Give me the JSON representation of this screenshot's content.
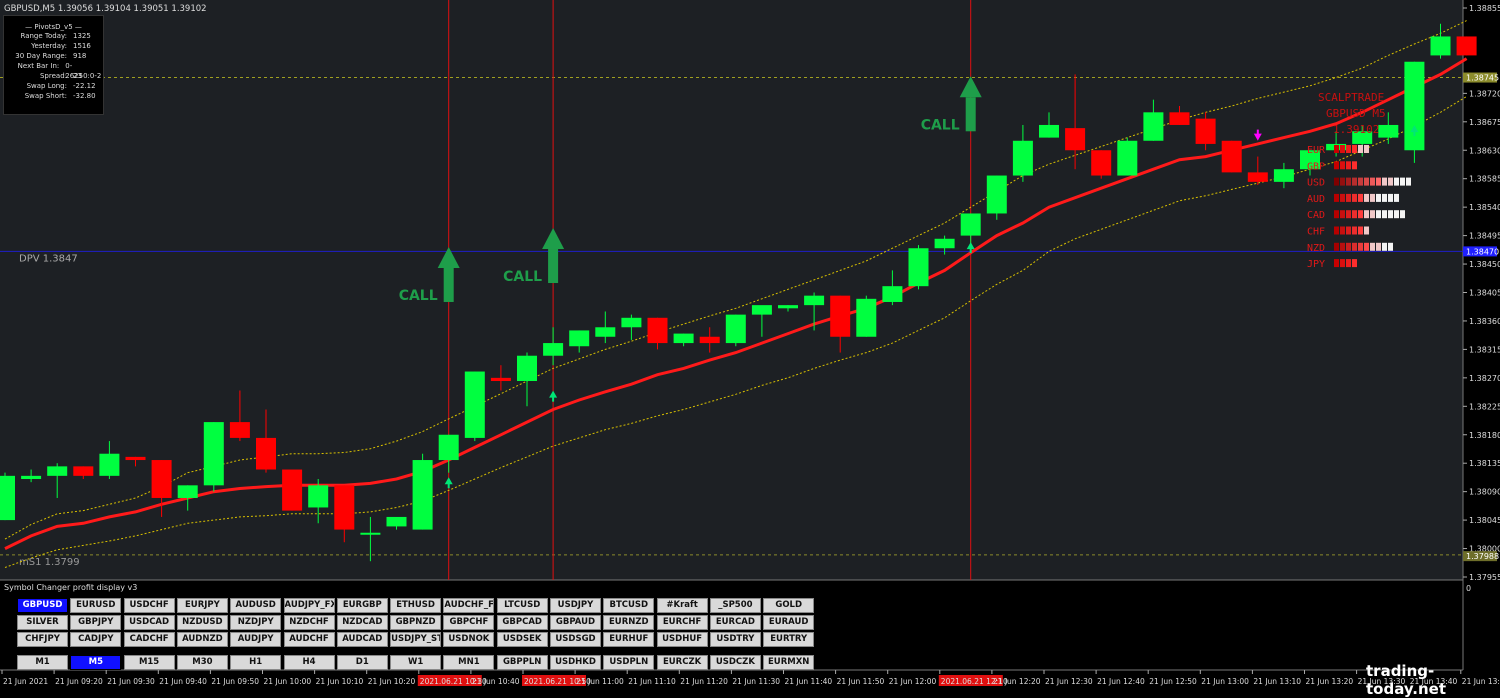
{
  "header": {
    "symbol_line": "GBPUSD,M5  1.39056 1.39104 1.39051 1.39102"
  },
  "info_panel": {
    "title": "PivotsD_v5",
    "rows": [
      {
        "label": "Range  Today:",
        "value": "1325"
      },
      {
        "label": "Yesterday:",
        "value": "1516"
      },
      {
        "label": "30 Day Range:",
        "value": "918"
      },
      {
        "label": "Next Bar In:",
        "value": "0-26250:0-2"
      },
      {
        "label": "Spread:",
        "value": "23"
      },
      {
        "label": "Swap  Long:",
        "value": "-22.12"
      },
      {
        "label": "Swap  Short:",
        "value": "-32.80"
      }
    ]
  },
  "levels": [
    {
      "text": "DPV  1.3847",
      "price": 1.3847,
      "color": "#1e1ec8"
    },
    {
      "text": "mS1  1.3799",
      "price": 1.3799,
      "color": "#8a8a2a"
    },
    {
      "text": "",
      "price": 1.38745,
      "color": "#a0a020"
    }
  ],
  "price_axis": {
    "ticks": [
      "1.38855",
      "1.38720",
      "1.38675",
      "1.38630",
      "1.38585",
      "1.38540",
      "1.38495",
      "1.38450",
      "1.38405",
      "1.38360",
      "1.38315",
      "1.38270",
      "1.38225",
      "1.38180",
      "1.38135",
      "1.38090",
      "1.38045",
      "1.38000",
      "1.37955"
    ],
    "tick_values": [
      1.38855,
      1.3872,
      1.38675,
      1.3863,
      1.38585,
      1.3854,
      1.38495,
      1.3845,
      1.38405,
      1.3836,
      1.38315,
      1.3827,
      1.38225,
      1.3818,
      1.38135,
      1.3809,
      1.38045,
      1.38,
      1.37955
    ],
    "highlight_labels": [
      {
        "text": "1.38745",
        "price": 1.38745,
        "color": "#8c8c2c"
      },
      {
        "text": "1.38470",
        "price": 1.3847,
        "color": "#2020ff"
      },
      {
        "text": "1.37988",
        "price": 1.37988,
        "color": "#6e6e2a"
      }
    ],
    "subwindow_label": "0"
  },
  "time_axis": {
    "labels": [
      "21 Jun 2021",
      "21 Jun 09:20",
      "21 Jun 09:30",
      "21 Jun 09:40",
      "21 Jun 09:50",
      "21 Jun 10:00",
      "21 Jun 10:10",
      "21 Jun 10:20",
      "2021.06.21 10:30",
      "21 Jun 10:40",
      "2021.06.21 10:50",
      "21 Jun 11:00",
      "21 Jun 11:10",
      "21 Jun 11:20",
      "21 Jun 11:30",
      "21 Jun 11:40",
      "21 Jun 11:50",
      "21 Jun 12:00",
      "2021.06.21 12:10",
      "21 Jun 12:20",
      "21 Jun 12:30",
      "21 Jun 12:40",
      "21 Jun 12:50",
      "21 Jun 13:00",
      "21 Jun 13:10",
      "21 Jun 13:20",
      "21 Jun 13:30",
      "21 Jun 13:40",
      "21 Jun 13:5"
    ],
    "highlighted": [
      8,
      10,
      18
    ]
  },
  "chart_data": {
    "type": "candlestick",
    "candles": [
      {
        "o": 1.38045,
        "h": 1.3812,
        "l": 1.38045,
        "c": 1.38115
      },
      {
        "o": 1.3811,
        "h": 1.38125,
        "l": 1.38105,
        "c": 1.38115
      },
      {
        "o": 1.38115,
        "h": 1.38135,
        "l": 1.3808,
        "c": 1.3813
      },
      {
        "o": 1.3813,
        "h": 1.3813,
        "l": 1.3811,
        "c": 1.38115
      },
      {
        "o": 1.38115,
        "h": 1.3817,
        "l": 1.3811,
        "c": 1.3815
      },
      {
        "o": 1.38145,
        "h": 1.38145,
        "l": 1.3813,
        "c": 1.3814
      },
      {
        "o": 1.3814,
        "h": 1.3814,
        "l": 1.3805,
        "c": 1.3808
      },
      {
        "o": 1.3808,
        "h": 1.381,
        "l": 1.3806,
        "c": 1.381
      },
      {
        "o": 1.381,
        "h": 1.382,
        "l": 1.3809,
        "c": 1.382
      },
      {
        "o": 1.382,
        "h": 1.3825,
        "l": 1.3817,
        "c": 1.38175
      },
      {
        "o": 1.38175,
        "h": 1.3822,
        "l": 1.3812,
        "c": 1.38125
      },
      {
        "o": 1.38125,
        "h": 1.3812,
        "l": 1.3806,
        "c": 1.3806
      },
      {
        "o": 1.38065,
        "h": 1.3811,
        "l": 1.3804,
        "c": 1.381
      },
      {
        "o": 1.381,
        "h": 1.381,
        "l": 1.3801,
        "c": 1.3803
      },
      {
        "o": 1.38025,
        "h": 1.3805,
        "l": 1.3798,
        "c": 1.38025
      },
      {
        "o": 1.38035,
        "h": 1.3805,
        "l": 1.3803,
        "c": 1.3805
      },
      {
        "o": 1.3803,
        "h": 1.3815,
        "l": 1.3803,
        "c": 1.3814
      },
      {
        "o": 1.3814,
        "h": 1.3818,
        "l": 1.3812,
        "c": 1.3818
      },
      {
        "o": 1.38175,
        "h": 1.3828,
        "l": 1.3817,
        "c": 1.3828
      },
      {
        "o": 1.3827,
        "h": 1.3829,
        "l": 1.3825,
        "c": 1.38265
      },
      {
        "o": 1.38265,
        "h": 1.3831,
        "l": 1.38225,
        "c": 1.38305
      },
      {
        "o": 1.38305,
        "h": 1.3835,
        "l": 1.3829,
        "c": 1.38325
      },
      {
        "o": 1.3832,
        "h": 1.38345,
        "l": 1.3831,
        "c": 1.38345
      },
      {
        "o": 1.38335,
        "h": 1.38375,
        "l": 1.38325,
        "c": 1.3835
      },
      {
        "o": 1.3835,
        "h": 1.3837,
        "l": 1.3833,
        "c": 1.38365
      },
      {
        "o": 1.38365,
        "h": 1.38365,
        "l": 1.38315,
        "c": 1.38325
      },
      {
        "o": 1.38325,
        "h": 1.3834,
        "l": 1.3832,
        "c": 1.3834
      },
      {
        "o": 1.38335,
        "h": 1.3835,
        "l": 1.3831,
        "c": 1.38325
      },
      {
        "o": 1.38325,
        "h": 1.3837,
        "l": 1.3832,
        "c": 1.3837
      },
      {
        "o": 1.3837,
        "h": 1.3838,
        "l": 1.38335,
        "c": 1.38385
      },
      {
        "o": 1.3838,
        "h": 1.38385,
        "l": 1.38375,
        "c": 1.38385
      },
      {
        "o": 1.38385,
        "h": 1.38405,
        "l": 1.38345,
        "c": 1.384
      },
      {
        "o": 1.384,
        "h": 1.384,
        "l": 1.3831,
        "c": 1.38335
      },
      {
        "o": 1.38335,
        "h": 1.384,
        "l": 1.38335,
        "c": 1.38395
      },
      {
        "o": 1.3839,
        "h": 1.3844,
        "l": 1.38385,
        "c": 1.38415
      },
      {
        "o": 1.38415,
        "h": 1.3848,
        "l": 1.3841,
        "c": 1.38475
      },
      {
        "o": 1.38475,
        "h": 1.38495,
        "l": 1.38465,
        "c": 1.3849
      },
      {
        "o": 1.38495,
        "h": 1.3853,
        "l": 1.3848,
        "c": 1.3853
      },
      {
        "o": 1.3853,
        "h": 1.3859,
        "l": 1.3852,
        "c": 1.3859
      },
      {
        "o": 1.3859,
        "h": 1.3867,
        "l": 1.3858,
        "c": 1.38645
      },
      {
        "o": 1.3865,
        "h": 1.3869,
        "l": 1.3865,
        "c": 1.3867
      },
      {
        "o": 1.38665,
        "h": 1.3875,
        "l": 1.386,
        "c": 1.3863
      },
      {
        "o": 1.3863,
        "h": 1.3863,
        "l": 1.38585,
        "c": 1.3859
      },
      {
        "o": 1.3859,
        "h": 1.3865,
        "l": 1.3859,
        "c": 1.38645
      },
      {
        "o": 1.38645,
        "h": 1.3871,
        "l": 1.38645,
        "c": 1.3869
      },
      {
        "o": 1.3869,
        "h": 1.387,
        "l": 1.3867,
        "c": 1.3867
      },
      {
        "o": 1.3868,
        "h": 1.3869,
        "l": 1.3863,
        "c": 1.3864
      },
      {
        "o": 1.38645,
        "h": 1.38645,
        "l": 1.38595,
        "c": 1.38595
      },
      {
        "o": 1.38595,
        "h": 1.3862,
        "l": 1.38575,
        "c": 1.3858
      },
      {
        "o": 1.3858,
        "h": 1.3861,
        "l": 1.3857,
        "c": 1.386
      },
      {
        "o": 1.386,
        "h": 1.3863,
        "l": 1.3859,
        "c": 1.3863
      },
      {
        "o": 1.3863,
        "h": 1.3866,
        "l": 1.3862,
        "c": 1.3864
      },
      {
        "o": 1.3864,
        "h": 1.3867,
        "l": 1.3862,
        "c": 1.3866
      },
      {
        "o": 1.3865,
        "h": 1.3869,
        "l": 1.3864,
        "c": 1.3867
      },
      {
        "o": 1.3863,
        "h": 1.3877,
        "l": 1.3861,
        "c": 1.3877
      },
      {
        "o": 1.3878,
        "h": 1.3883,
        "l": 1.38775,
        "c": 1.3881
      },
      {
        "o": 1.3881,
        "h": 1.3881,
        "l": 1.3878,
        "c": 1.3878
      }
    ],
    "bull_color": "#00ff40",
    "bear_color": "#ff0000",
    "ma_red": [
      1.38,
      1.3802,
      1.38035,
      1.3804,
      1.3805,
      1.38058,
      1.3807,
      1.3808,
      1.3809,
      1.38095,
      1.38098,
      1.381,
      1.381,
      1.381,
      1.38103,
      1.3811,
      1.38122,
      1.3814,
      1.3816,
      1.3818,
      1.382,
      1.3822,
      1.38235,
      1.38248,
      1.3826,
      1.38275,
      1.38285,
      1.38298,
      1.3831,
      1.38325,
      1.3834,
      1.38355,
      1.38368,
      1.3838,
      1.38398,
      1.3842,
      1.3844,
      1.38468,
      1.38495,
      1.38515,
      1.3854,
      1.38555,
      1.3857,
      1.38585,
      1.386,
      1.38615,
      1.3862,
      1.3863,
      1.3864,
      1.3865,
      1.3866,
      1.38672,
      1.3869,
      1.3871,
      1.3873,
      1.3875,
      1.38775
    ],
    "ma_upper": [
      1.38015,
      1.38038,
      1.38055,
      1.3806,
      1.3807,
      1.3808,
      1.38098,
      1.3812,
      1.3813,
      1.3814,
      1.38145,
      1.3815,
      1.3815,
      1.38152,
      1.38158,
      1.3817,
      1.38185,
      1.38205,
      1.38225,
      1.38245,
      1.38265,
      1.38285,
      1.383,
      1.38315,
      1.38328,
      1.38342,
      1.38355,
      1.38368,
      1.3838,
      1.38395,
      1.3841,
      1.38425,
      1.3844,
      1.38455,
      1.38475,
      1.38495,
      1.38515,
      1.3854,
      1.38565,
      1.3859,
      1.38608,
      1.38622,
      1.38636,
      1.3865,
      1.38664,
      1.38678,
      1.3869,
      1.387,
      1.38712,
      1.38722,
      1.38732,
      1.38745,
      1.3876,
      1.3878,
      1.38798,
      1.38815,
      1.38835
    ],
    "ma_lower": [
      1.3797,
      1.37985,
      1.37998,
      1.38005,
      1.38012,
      1.3802,
      1.3803,
      1.3804,
      1.38045,
      1.3805,
      1.38052,
      1.38055,
      1.38055,
      1.38055,
      1.38058,
      1.38065,
      1.38075,
      1.38092,
      1.3811,
      1.38128,
      1.38145,
      1.38162,
      1.38175,
      1.38188,
      1.38198,
      1.3821,
      1.3822,
      1.38232,
      1.38244,
      1.38258,
      1.3827,
      1.38285,
      1.38298,
      1.3831,
      1.38325,
      1.38345,
      1.38365,
      1.38392,
      1.38418,
      1.3844,
      1.3847,
      1.3849,
      1.38505,
      1.3852,
      1.38535,
      1.3855,
      1.38558,
      1.38568,
      1.38578,
      1.38588,
      1.386,
      1.38612,
      1.3863,
      1.38648,
      1.38668,
      1.3869,
      1.38715
    ],
    "vertical_lines_at": [
      17,
      21,
      37
    ],
    "call_signals": [
      {
        "text": "CALL",
        "index": 17,
        "price": 1.3839
      },
      {
        "text": "CALL",
        "index": 21,
        "price": 1.3842
      },
      {
        "text": "CALL",
        "index": 37,
        "price": 1.3866
      }
    ],
    "arrows": [
      {
        "index": 17,
        "price": 1.38108,
        "dir": "up",
        "color": "#00e676"
      },
      {
        "index": 21,
        "price": 1.38245,
        "dir": "up",
        "color": "#00e676"
      },
      {
        "index": 37,
        "price": 1.3848,
        "dir": "up",
        "color": "#00e676"
      },
      {
        "index": 48,
        "price": 1.3865,
        "dir": "down",
        "color": "#ff00ff"
      },
      {
        "index": 54,
        "price": 1.38665,
        "dir": "up",
        "color": "#00e676"
      }
    ],
    "watermark": {
      "line1": "SCALPTRADE",
      "line2": "GBPUSD M5",
      "line3": "1.39102"
    },
    "strength": [
      {
        "name": "EUR",
        "red": 4,
        "white": 2
      },
      {
        "name": "GBP",
        "red": 4,
        "white": 0
      },
      {
        "name": "USD",
        "red": 8,
        "white": 5
      },
      {
        "name": "AUD",
        "red": 5,
        "white": 6
      },
      {
        "name": "CAD",
        "red": 5,
        "white": 7
      },
      {
        "name": "CHF",
        "red": 5,
        "white": 1
      },
      {
        "name": "NZD",
        "red": 6,
        "white": 4
      },
      {
        "name": "JPY",
        "red": 4,
        "white": 0
      }
    ]
  },
  "symbol_changer": {
    "title": "Symbol Changer profit display v3",
    "rows": [
      [
        "GBPUSD",
        "EURUSD",
        "USDCHF",
        "EURJPY",
        "AUDUSD",
        "AUDJPY_FX",
        "EURGBP",
        "ETHUSD",
        "AUDCHF_FX",
        "LTCUSD",
        "USDJPY",
        "BTCUSD",
        "#Kraft",
        "_SP500",
        "GOLD"
      ],
      [
        "SILVER",
        "GBPJPY",
        "USDCAD",
        "NZDUSD",
        "NZDJPY",
        "NZDCHF",
        "NZDCAD",
        "GBPNZD",
        "GBPCHF",
        "GBPCAD",
        "GBPAUD",
        "EURNZD",
        "EURCHF",
        "EURCAD",
        "EURAUD"
      ],
      [
        "CHFJPY",
        "CADJPY",
        "CADCHF",
        "AUDNZD",
        "AUDJPY",
        "AUDCHF",
        "AUDCAD",
        "USDJPY_STP",
        "USDNOK",
        "USDSEK",
        "USDSGD",
        "EURHUF",
        "USDHUF",
        "USDTRY",
        "EURTRY"
      ],
      [
        "M1",
        "M5",
        "M15",
        "M30",
        "H1",
        "H4",
        "D1",
        "W1",
        "MN1",
        "GBPPLN",
        "USDHKD",
        "USDPLN",
        "EURCZK",
        "USDCZK",
        "EURMXN"
      ]
    ],
    "active_symbol": "GBPUSD",
    "active_timeframe": "M5"
  },
  "watermark_site": "trading-today.net"
}
